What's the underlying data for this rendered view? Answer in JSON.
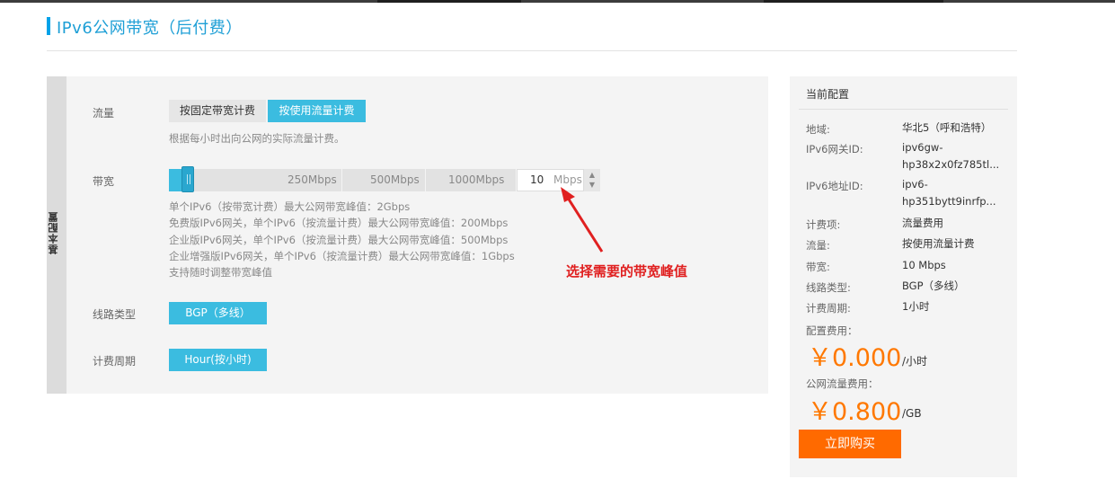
{
  "page": {
    "title": "IPv6公网带宽（后付费）"
  },
  "config": {
    "section_tab": "基本配置",
    "traffic": {
      "label": "流量",
      "options": [
        "按固定带宽计费",
        "按使用流量计费"
      ],
      "selected": "按使用流量计费",
      "hint": "根据每小时出向公网的实际流量计费。"
    },
    "bandwidth": {
      "label": "带宽",
      "ticks": [
        "250Mbps",
        "500Mbps",
        "1000Mbps"
      ],
      "value": "10",
      "unit": "Mbps",
      "slider_fraction": 0.01,
      "notes": [
        "单个IPv6（按带宽计费）最大公网带宽峰值：2Gbps",
        "免费版IPv6网关，单个IPv6（按流量计费）最大公网带宽峰值：200Mbps",
        "企业版IPv6网关，单个IPv6（按流量计费）最大公网带宽峰值：500Mbps",
        "企业增强版IPv6网关，单个IPv6（按流量计费）最大公网带宽峰值：1Gbps",
        "支持随时调整带宽峰值"
      ]
    },
    "line_type": {
      "label": "线路类型",
      "value": "BGP（多线）"
    },
    "billing_cycle": {
      "label": "计费周期",
      "value": "Hour(按小时)"
    }
  },
  "annotation": {
    "text": "选择需要的带宽峰值",
    "color": "#e02020"
  },
  "summary": {
    "title": "当前配置",
    "rows": [
      {
        "label": "地域:",
        "value": "华北5（呼和浩特）"
      },
      {
        "label": "IPv6网关ID:",
        "value": "ipv6gw-\nhp38x2x0fz785tl..."
      },
      {
        "label": "IPv6地址ID:",
        "value": "ipv6-\nhp351bytt9inrfp..."
      },
      {
        "label": "计费项:",
        "value": "流量费用"
      },
      {
        "label": "流量:",
        "value": "按使用流量计费"
      },
      {
        "label": "带宽:",
        "value": "10 Mbps"
      },
      {
        "label": "线路类型:",
        "value": "BGP（多线）"
      },
      {
        "label": "计费周期:",
        "value": "1小时"
      }
    ],
    "config_fee_label": "配置费用：",
    "config_fee": "￥0.000",
    "config_fee_unit": "/小时",
    "traffic_fee_label": "公网流量费用：",
    "traffic_fee": "￥0.800",
    "traffic_fee_unit": "/GB",
    "buy_label": "立即购买"
  },
  "colors": {
    "accent": "#3bbce0",
    "title_blue": "#1e9fd6",
    "price_orange": "#ff7800",
    "buy_button": "#ff6a00"
  },
  "icons": {
    "stepper_up": "caret-up-icon",
    "stepper_down": "caret-down-icon",
    "slider_grip": "grip-icon"
  }
}
